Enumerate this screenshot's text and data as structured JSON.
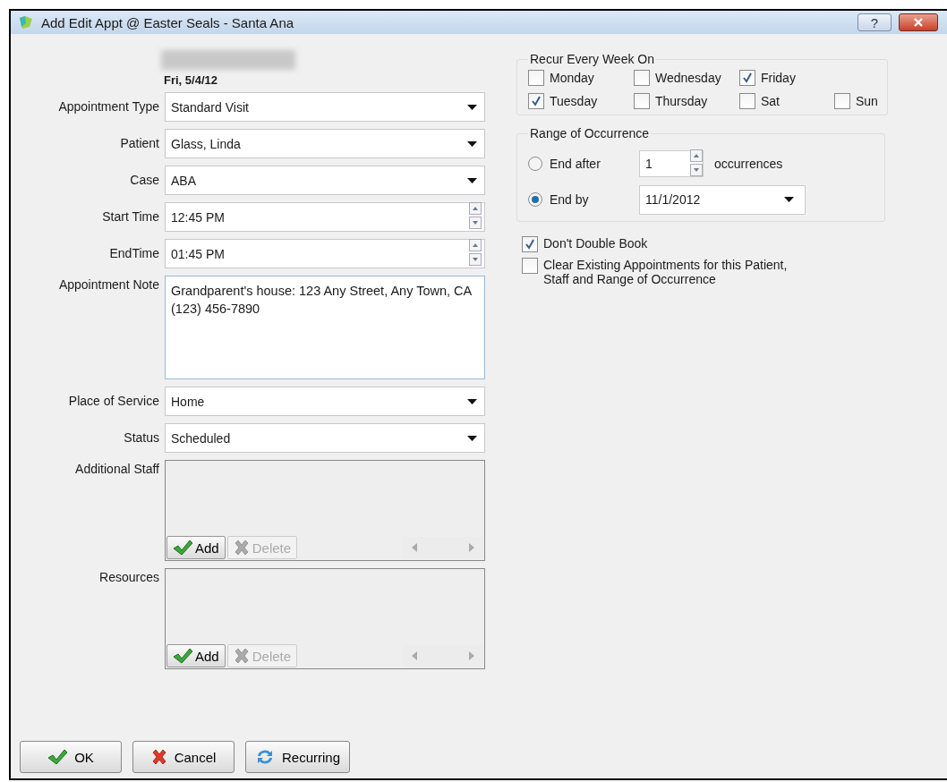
{
  "window": {
    "title": "Add Edit Appt @ Easter Seals - Santa Ana",
    "help": "?"
  },
  "header": {
    "date": "Fri, 5/4/12"
  },
  "fields": [
    {
      "kind": "dropdown",
      "label": "Appointment Type",
      "value": "Standard Visit"
    },
    {
      "kind": "dropdown",
      "label": "Patient",
      "value": "Glass, Linda"
    },
    {
      "kind": "dropdown",
      "label": "Case",
      "value": "ABA"
    },
    {
      "kind": "spin",
      "label": "Start Time",
      "value": "12:45 PM"
    },
    {
      "kind": "spin",
      "label": "EndTime",
      "value": "01:45 PM"
    },
    {
      "kind": "note",
      "label": "Appointment Note",
      "value": "Grandparent's house: 123 Any Street, Any Town, CA (123) 456-7890"
    },
    {
      "kind": "dropdown",
      "label": "Place of Service",
      "value": "Home"
    },
    {
      "kind": "dropdown",
      "label": "Status",
      "value": "Scheduled"
    },
    {
      "kind": "list",
      "label": "Additional Staff",
      "buttons": [
        {
          "kind": "add",
          "label": "Add",
          "disabled": false
        },
        {
          "kind": "delete",
          "label": "Delete",
          "disabled": true
        }
      ]
    },
    {
      "kind": "list",
      "label": "Resources",
      "buttons": [
        {
          "kind": "add",
          "label": "Add",
          "disabled": false
        },
        {
          "kind": "delete",
          "label": "Delete",
          "disabled": true
        }
      ]
    }
  ],
  "recur": {
    "title": "Recur Every Week On",
    "rows": [
      [
        {
          "label": "Monday",
          "checked": false
        },
        {
          "label": "Wednesday",
          "checked": false
        },
        {
          "label": "Friday",
          "checked": true
        }
      ],
      [
        {
          "label": "Tuesday",
          "checked": true
        },
        {
          "label": "Thursday",
          "checked": false
        },
        {
          "label": "Sat",
          "checked": false
        },
        {
          "label": "Sun",
          "checked": false
        }
      ]
    ]
  },
  "range": {
    "title": "Range of Occurrence",
    "options": [
      {
        "kind": "count",
        "label": "End after",
        "selected": false,
        "value": "1",
        "suffix": "occurrences"
      },
      {
        "kind": "date",
        "label": "End by",
        "selected": true,
        "value": "11/1/2012"
      }
    ]
  },
  "options": [
    {
      "label": "Don't Double Book",
      "checked": true
    },
    {
      "label": "Clear Existing Appointments for this Patient, Staff and Range of Occurrence",
      "checked": false
    }
  ],
  "footer_buttons": [
    {
      "kind": "ok",
      "label": "OK"
    },
    {
      "kind": "cancel",
      "label": "Cancel"
    },
    {
      "kind": "recurring",
      "label": "Recurring"
    }
  ]
}
